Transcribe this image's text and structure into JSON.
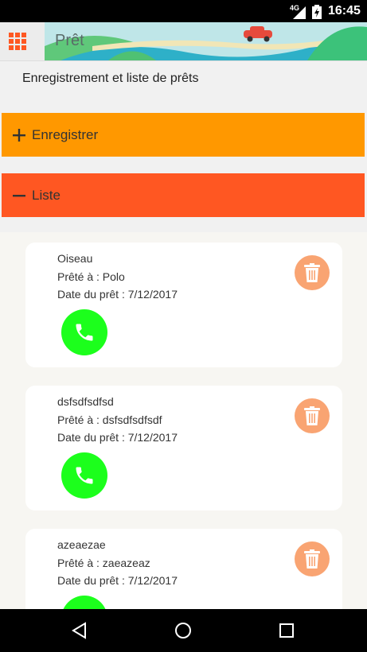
{
  "status_bar": {
    "network": "4G",
    "time": "16:45"
  },
  "app_bar": {
    "title": "Prêt"
  },
  "subtitle": "Enregistrement et liste de prêts",
  "sections": {
    "register": {
      "label": "Enregistrer",
      "color": "#ff9800"
    },
    "list": {
      "label": "Liste",
      "color": "#ff5722"
    }
  },
  "loans": [
    {
      "name": "Oiseau",
      "lent_to": "Prêté à : Polo",
      "date": "Date du prêt : 7/12/2017"
    },
    {
      "name": "dsfsdfsdfsd",
      "lent_to": "Prêté à : dsfsdfsdfsdf",
      "date": "Date du prêt : 7/12/2017"
    },
    {
      "name": "azeaezae",
      "lent_to": "Prêté à : zaeazeaz",
      "date": "Date du prêt : 7/12/2017"
    }
  ],
  "colors": {
    "delete_button": "#f9a472",
    "call_button": "#1cff1c",
    "menu_icon": "#ff5722"
  },
  "icons": [
    "grid-menu-icon",
    "plus-icon",
    "minus-icon",
    "trash-icon",
    "phone-icon",
    "back-icon",
    "home-icon",
    "recents-icon"
  ]
}
